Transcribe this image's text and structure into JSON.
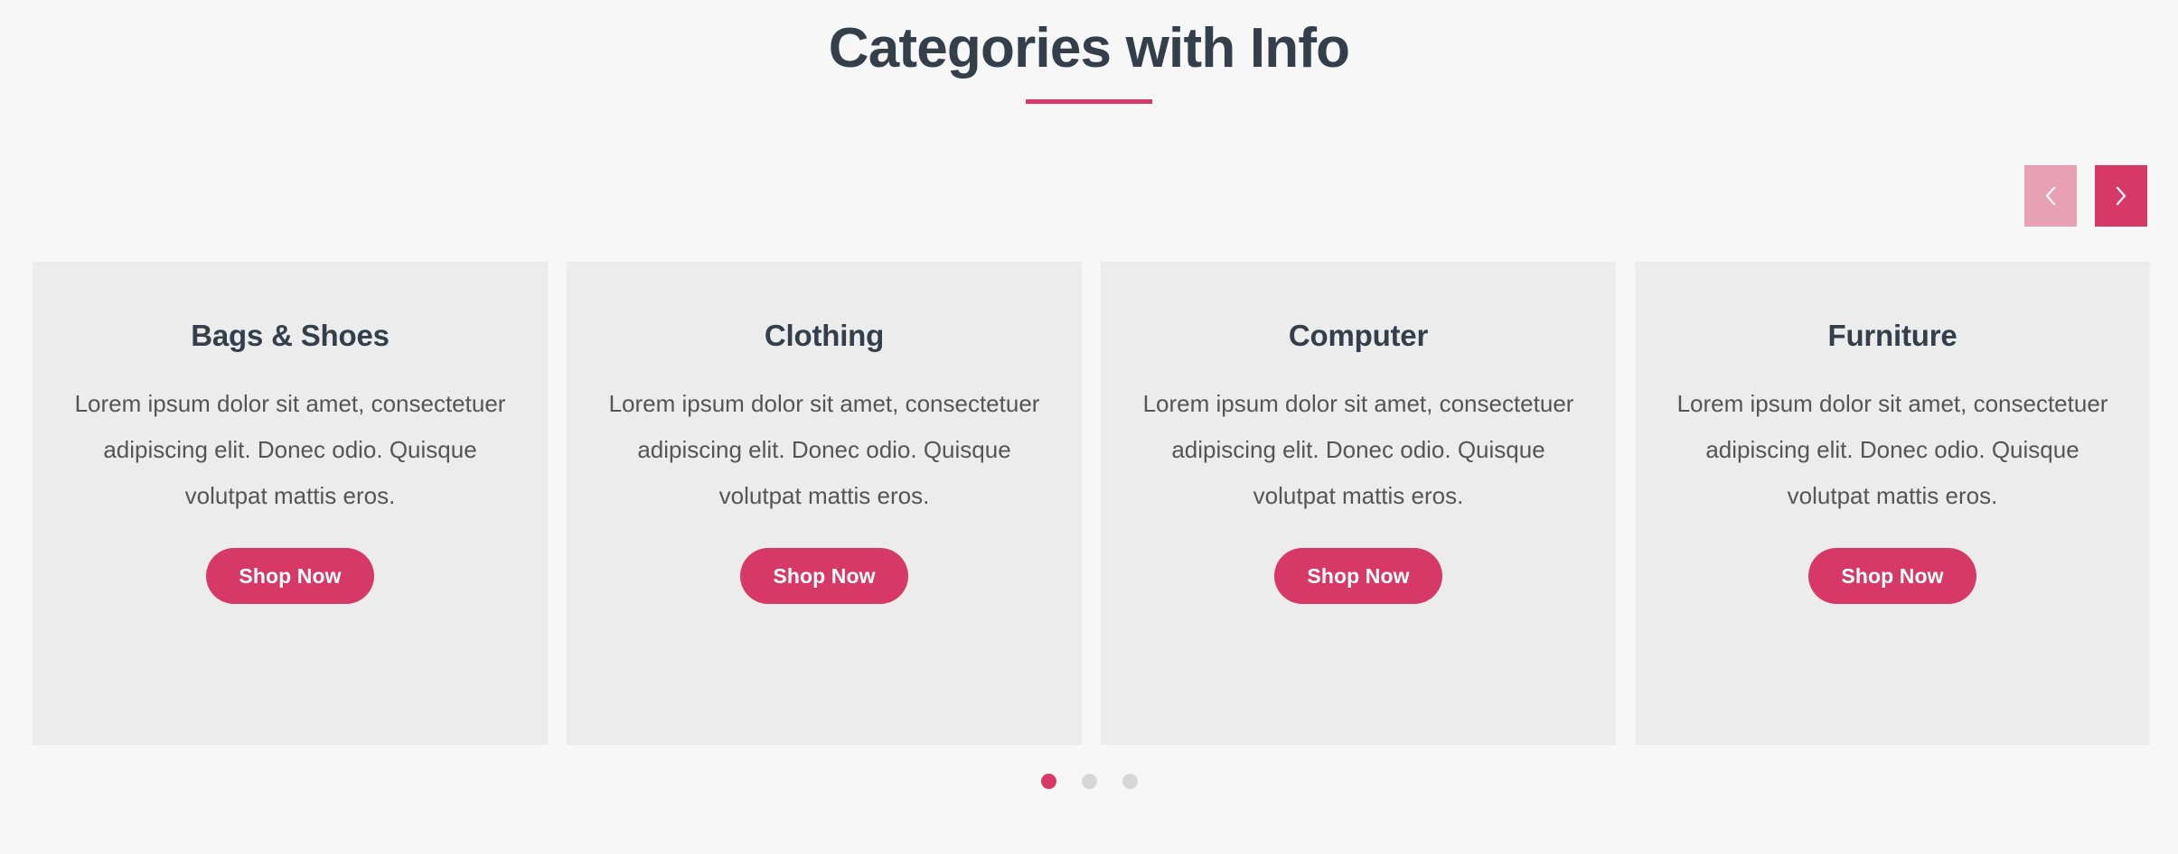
{
  "section": {
    "title": "Categories with Info",
    "accent_color": "#d63867"
  },
  "nav": {
    "prev_label": "‹",
    "next_label": "›",
    "prev_icon": "chevron-left-icon",
    "next_icon": "chevron-right-icon",
    "prev_color": "#e8a0b5",
    "next_color": "#d63867"
  },
  "cards": [
    {
      "title": "Bags & Shoes",
      "description": "Lorem ipsum dolor sit amet, consectetuer adipiscing elit. Donec odio. Quisque volutpat mattis eros.",
      "button_label": "Shop Now"
    },
    {
      "title": "Clothing",
      "description": "Lorem ipsum dolor sit amet, consectetuer adipiscing elit. Donec odio. Quisque volutpat mattis eros.",
      "button_label": "Shop Now"
    },
    {
      "title": "Computer",
      "description": "Lorem ipsum dolor sit amet, consectetuer adipiscing elit. Donec odio. Quisque volutpat mattis eros.",
      "button_label": "Shop Now"
    },
    {
      "title": "Furniture",
      "description": "Lorem ipsum dolor sit amet, consectetuer adipiscing elit. Donec odio. Quisque volutpat mattis eros.",
      "button_label": "Shop Now"
    }
  ],
  "pagination": {
    "count": 3,
    "active_index": 0,
    "active_color": "#d63867",
    "inactive_color": "#d6d6d6"
  },
  "theme": {
    "page_background": "#f7f7f7",
    "card_background": "#ececec",
    "heading_color": "#343f4b",
    "body_text_color": "#555555",
    "accent": "#d63867"
  }
}
